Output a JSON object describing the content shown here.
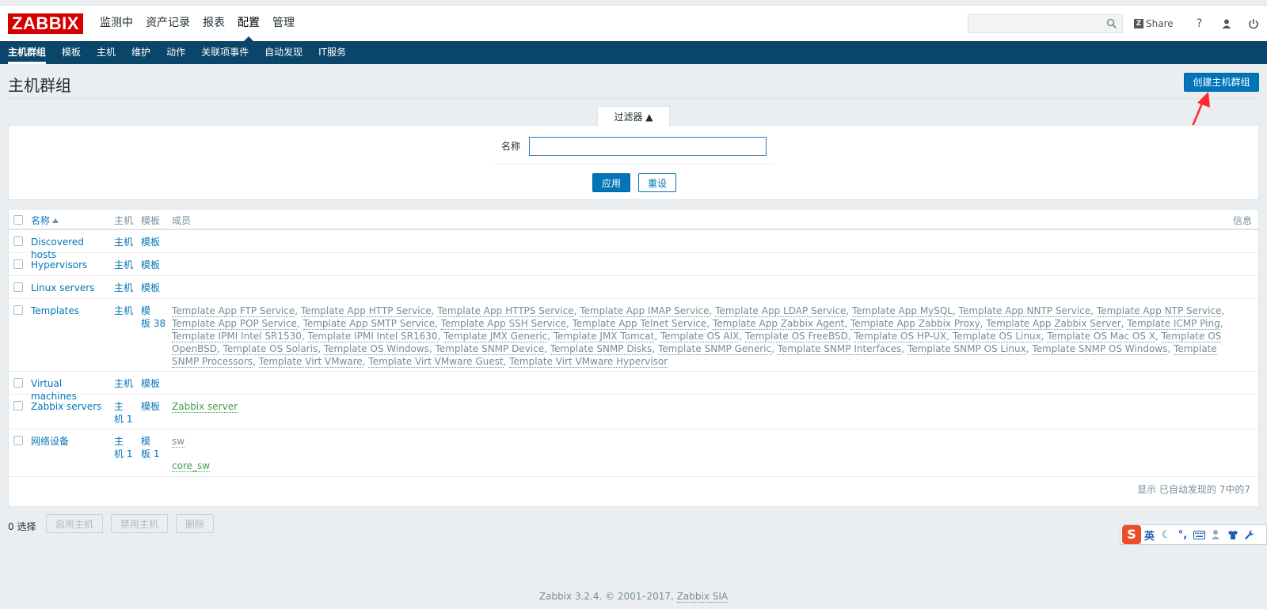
{
  "header": {
    "logo": "ZABBIX",
    "main_nav": [
      "监测中",
      "资产记录",
      "报表",
      "配置",
      "管理"
    ],
    "active_main": "配置",
    "search_placeholder": "",
    "share_label": "Share",
    "help_label": "?"
  },
  "subnav": [
    "主机群组",
    "模板",
    "主机",
    "维护",
    "动作",
    "关联项事件",
    "自动发现",
    "IT服务"
  ],
  "page": {
    "title": "主机群组",
    "create_button": "创建主机群组"
  },
  "filter": {
    "tab_label": "过滤器 ▲",
    "name_label": "名称",
    "name_value": "",
    "apply_label": "应用",
    "reset_label": "重设"
  },
  "table": {
    "headers": {
      "name": "名称",
      "hosts": "主机",
      "templates": "模板",
      "members": "成员",
      "info": "信息"
    },
    "rows": [
      {
        "name": "Discovered hosts",
        "hosts": "主机",
        "templates": "模板"
      },
      {
        "name": "Hypervisors",
        "hosts": "主机",
        "templates": "模板"
      },
      {
        "name": "Linux servers",
        "hosts": "主机",
        "templates": "模板"
      },
      {
        "name": "Templates",
        "hosts": "主机",
        "templates_line1": "模",
        "templates_line2": "板 38",
        "members": [
          "Template App FTP Service",
          "Template App HTTP Service",
          "Template App HTTPS Service",
          "Template App IMAP Service",
          "Template App LDAP Service",
          "Template App MySQL",
          "Template App NNTP Service",
          "Template App NTP Service",
          "Template App POP Service",
          "Template App SMTP Service",
          "Template App SSH Service",
          "Template App Telnet Service",
          "Template App Zabbix Agent",
          "Template App Zabbix Proxy",
          "Template App Zabbix Server",
          "Template ICMP Ping",
          "Template IPMI Intel SR1530",
          "Template IPMI Intel SR1630",
          "Template JMX Generic",
          "Template JMX Tomcat",
          "Template OS AIX",
          "Template OS FreeBSD",
          "Template OS HP-UX",
          "Template OS Linux",
          "Template OS Mac OS X",
          "Template OS OpenBSD",
          "Template OS Solaris",
          "Template OS Windows",
          "Template SNMP Device",
          "Template SNMP Disks",
          "Template SNMP Generic",
          "Template SNMP Interfaces",
          "Template SNMP OS Linux",
          "Template SNMP OS Windows",
          "Template SNMP Processors",
          "Template Virt VMware",
          "Template Virt VMware Guest",
          "Template Virt VMware Hypervisor"
        ]
      },
      {
        "name": "Virtual machines",
        "hosts": "主机",
        "templates": "模板"
      },
      {
        "name": "Zabbix servers",
        "hosts_line1": "主",
        "hosts_line2": "机 1",
        "templates": "模板",
        "members": [
          "Zabbix server"
        ]
      },
      {
        "name": "网络设备",
        "hosts_line1": "主",
        "hosts_line2": "机 1",
        "templates_line1": "模",
        "templates_line2": "板 1",
        "member_template": "sw",
        "member_host": "core_sw"
      }
    ],
    "footer": "显示 已自动发现的 7中的7"
  },
  "actions": {
    "selected": "0 选择",
    "enable": "启用主机",
    "disable": "禁用主机",
    "delete": "删除"
  },
  "footer": {
    "text": "Zabbix 3.2.4. © 2001–2017,",
    "company": "Zabbix SIA"
  },
  "ime": {
    "logo": "S",
    "lang": "英"
  },
  "colors": {
    "brand_red": "#d40000",
    "nav_blue": "#0a466a",
    "button_blue": "#0275b8",
    "link_green": "#429e47",
    "annotation_red": "#ff2a2a"
  }
}
